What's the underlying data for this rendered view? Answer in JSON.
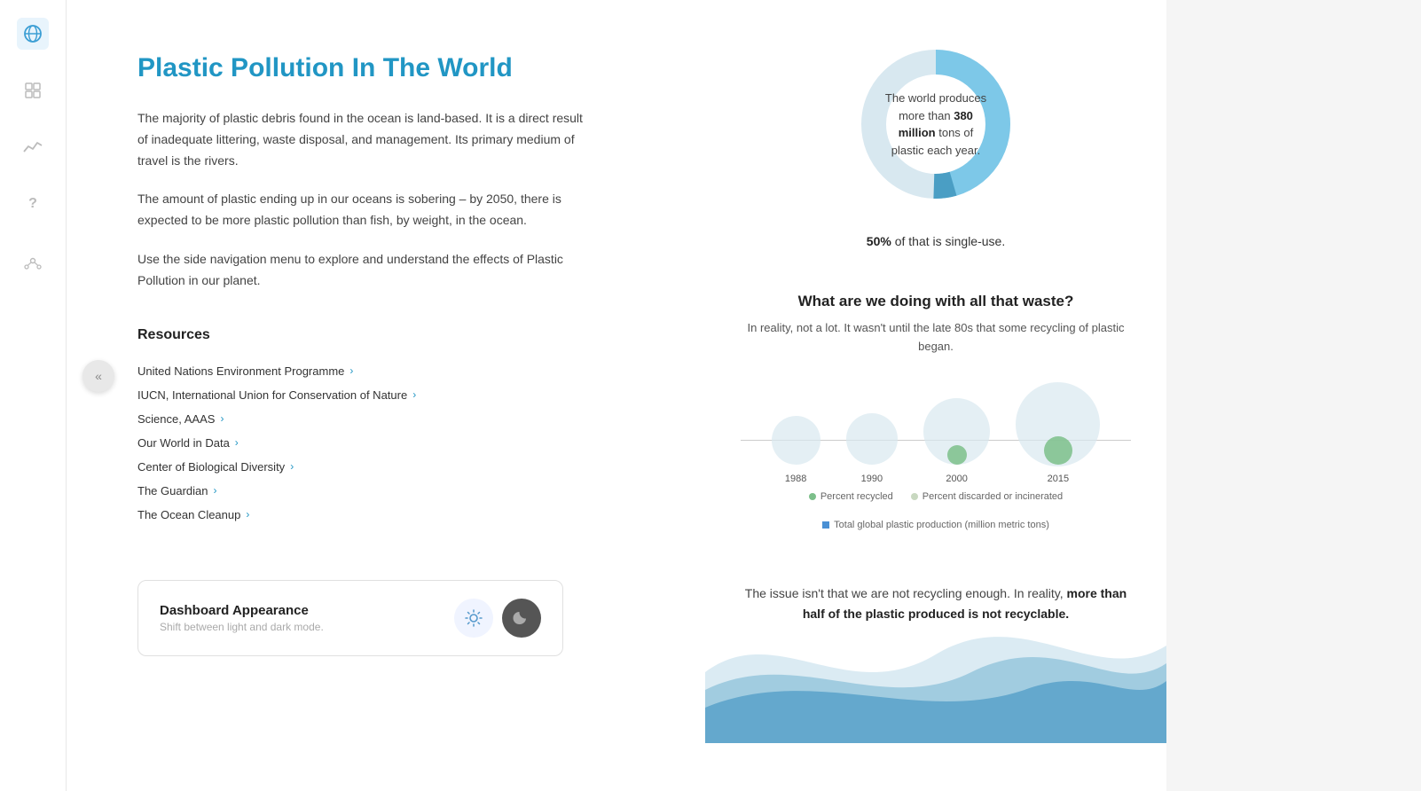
{
  "sidebar": {
    "icons": [
      {
        "name": "globe-icon",
        "symbol": "🌐",
        "active": true
      },
      {
        "name": "grid-icon",
        "symbol": "⊞",
        "active": false
      },
      {
        "name": "chart-icon",
        "symbol": "〜",
        "active": false
      },
      {
        "name": "question-icon",
        "symbol": "?",
        "active": false
      },
      {
        "name": "settings-icon",
        "symbol": "✦",
        "active": false
      }
    ]
  },
  "collapse_button": "«",
  "main": {
    "title": "Plastic Pollution In The World",
    "paragraphs": [
      "The majority of plastic debris found in the ocean is land-based. It is a direct result of inadequate littering, waste disposal, and management. Its primary medium of travel is the rivers.",
      "The amount of plastic ending up in our oceans is sobering – by 2050, there is expected to be more plastic pollution than fish, by weight, in the ocean.",
      "Use the side navigation menu to explore and understand the effects of Plastic Pollution in our planet."
    ],
    "resources_title": "Resources",
    "resources": [
      {
        "label": "United Nations Environment Programme"
      },
      {
        "label": "IUCN, International Union for Conservation of Nature"
      },
      {
        "label": "Science, AAAS"
      },
      {
        "label": "Our World in Data"
      },
      {
        "label": "Center of Biological Diversity"
      },
      {
        "label": "The Guardian"
      },
      {
        "label": "The Ocean Cleanup"
      }
    ],
    "appearance_card": {
      "title": "Dashboard Appearance",
      "subtitle": "Shift between light and dark mode."
    }
  },
  "right": {
    "donut": {
      "center_text_normal": "The world produces more than ",
      "center_text_bold": "380 million",
      "center_text_end": " tons of plastic each year.",
      "single_use_bold": "50%",
      "single_use_text": " of that is single-use."
    },
    "waste": {
      "title": "What are we doing with all that waste?",
      "subtitle": "In reality, not a lot. It wasn't until the late 80s that some recycling of plastic began.",
      "years": [
        "1988",
        "1990",
        "2000",
        "2015"
      ],
      "legend": [
        {
          "label": "Percent recycled",
          "color": "#7cbf8a",
          "type": "dot"
        },
        {
          "label": "Percent discarded or incinerated",
          "color": "#c8d8c8",
          "type": "dot"
        },
        {
          "label": "Total global plastic production (million metric tons)",
          "color": "#4a90d4",
          "type": "square"
        }
      ]
    },
    "bottom_text_normal": "The issue isn't that we are not recycling enough. In reality, ",
    "bottom_text_bold": "more than half of the plastic produced is not recyclable."
  }
}
